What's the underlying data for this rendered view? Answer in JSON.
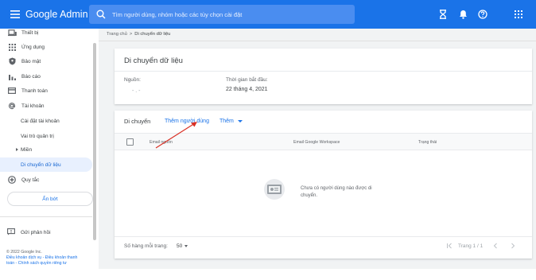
{
  "header": {
    "brand": "Google Admin",
    "search_placeholder": "Tìm người dùng, nhóm hoặc các tùy chọn cài đặt",
    "brand_color": "#1a73e8"
  },
  "sidebar": {
    "items": [
      {
        "label": "Thiết bị",
        "icon": "devices-icon"
      },
      {
        "label": "Ứng dụng",
        "icon": "apps-grid-icon"
      },
      {
        "label": "Bảo mật",
        "icon": "shield-icon"
      },
      {
        "label": "Báo cáo",
        "icon": "bar-chart-icon"
      },
      {
        "label": "Thanh toán",
        "icon": "credit-card-icon"
      },
      {
        "label": "Tài khoản",
        "icon": "at-sign-icon"
      }
    ],
    "sub_items": [
      "Cài đặt tài khoản",
      "Vai trò quản trị",
      "Miền"
    ],
    "active_item": "Di chuyển dữ liệu",
    "rules": {
      "label": "Quy tắc",
      "icon": "rules-icon"
    },
    "hide_button": "Ẩn bớt",
    "feedback": "Gửi phản hồi",
    "copyright": "© 2022 Google Inc.",
    "terms": "Điều khoản dịch vụ - Điều khoản thanh",
    "privacy": "toán - Chính sách quyền riêng tư"
  },
  "breadcrumb": {
    "home": "Trang chủ",
    "separator": ">",
    "current": "Di chuyển dữ liệu"
  },
  "migration_card": {
    "title": "Di chuyển dữ liệu",
    "source_label": "Nguồn:",
    "source_value": "- . -",
    "start_label": "Thời gian bắt đầu:",
    "start_value": "22 tháng 4, 2021"
  },
  "users_card": {
    "tab_title": "Di chuyển",
    "add_users": "Thêm người dùng",
    "more": "Thêm",
    "columns": [
      "Email nguồn",
      "Email Google Workspace",
      "Trạng thái"
    ],
    "empty_message": "Chưa có người dùng nào được di chuyển.",
    "rows_per_page_label": "Số hàng mỗi trang:",
    "rows_per_page_value": "50",
    "page_label": "Trang 1 / 1"
  },
  "annotation": {
    "arrow_color": "#d93025"
  }
}
